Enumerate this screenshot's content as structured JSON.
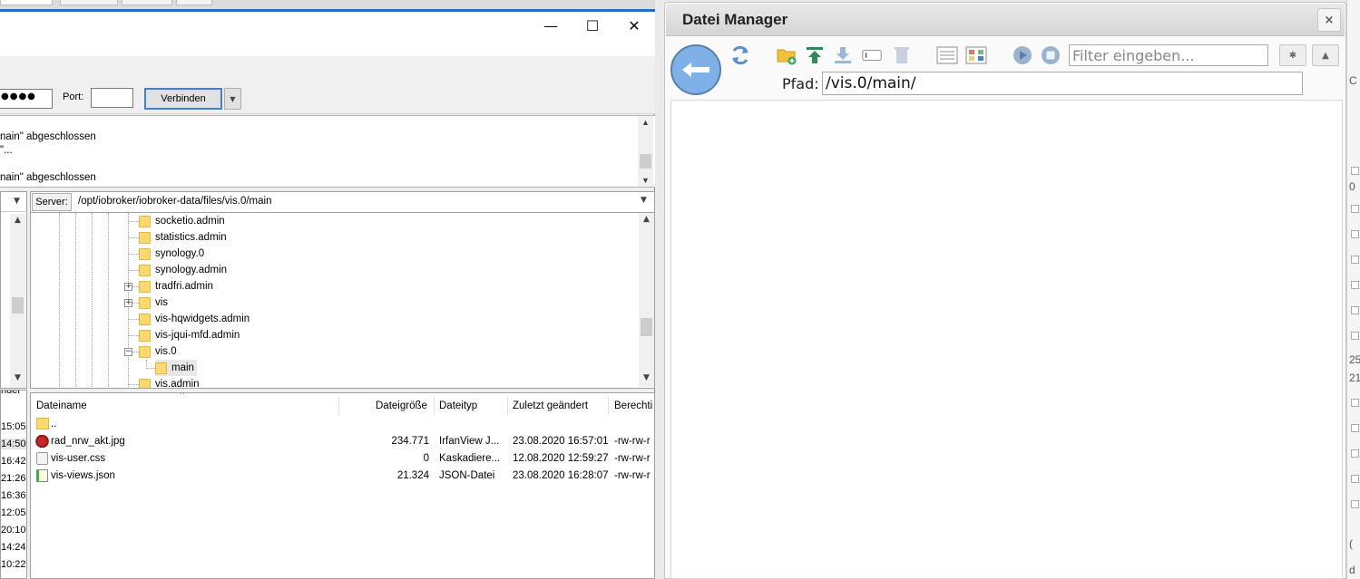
{
  "filezilla": {
    "window_controls": {
      "minimize": "—",
      "maximize": "☐",
      "close": "✕"
    },
    "quickconnect": {
      "password_masked": "●●●●",
      "port_label": "Port:",
      "port_value": "",
      "connect_button": "Verbinden",
      "dropdown_icon": "▼"
    },
    "log_lines": [
      "nain\" abgeschlossen",
      "\"...",
      "",
      "nain\" abgeschlossen"
    ],
    "server_label": "Server:",
    "server_path": "/opt/iobroker/iobroker-data/files/vis.0/main",
    "tree_items": [
      {
        "label": "socketio.admin",
        "expander": ""
      },
      {
        "label": "statistics.admin",
        "expander": ""
      },
      {
        "label": "synology.0",
        "expander": ""
      },
      {
        "label": "synology.admin",
        "expander": ""
      },
      {
        "label": "tradfri.admin",
        "expander": "+"
      },
      {
        "label": "vis",
        "expander": "+"
      },
      {
        "label": "vis-hqwidgets.admin",
        "expander": ""
      },
      {
        "label": "vis-jqui-mfd.admin",
        "expander": ""
      },
      {
        "label": "vis.0",
        "expander": "−"
      },
      {
        "label": "main",
        "expander": ""
      },
      {
        "label": "vis.admin",
        "expander": ""
      }
    ],
    "local_list_header": "nder",
    "local_times": [
      "15:05",
      "14:50",
      "16:42",
      "21:26",
      "16:36",
      "12:05",
      "20:10",
      "14:24",
      "10:22"
    ],
    "columns": {
      "name": "Dateiname",
      "size": "Dateigröße",
      "type": "Dateityp",
      "modified": "Zuletzt geändert",
      "perms": "Berechti"
    },
    "files": [
      {
        "name": "..",
        "size": "",
        "type": "",
        "modified": "",
        "perms": "",
        "icon": "folder-icon"
      },
      {
        "name": "rad_nrw_akt.jpg",
        "size": "234.771",
        "type": "IrfanView J...",
        "modified": "23.08.2020 16:57:01",
        "perms": "-rw-rw-r",
        "icon": "image-file-icon"
      },
      {
        "name": "vis-user.css",
        "size": "0",
        "type": "Kaskadiere...",
        "modified": "12.08.2020 12:59:27",
        "perms": "-rw-rw-r",
        "icon": "css-file-icon"
      },
      {
        "name": "vis-views.json",
        "size": "21.324",
        "type": "JSON-Datei",
        "modified": "23.08.2020 16:28:07",
        "perms": "-rw-rw-r",
        "icon": "json-file-icon"
      }
    ]
  },
  "dateimanager": {
    "title": "Datei Manager",
    "close_icon": "×",
    "filter_placeholder": "Filter eingeben...",
    "path_label": "Pfad:",
    "path_value": "/vis.0/main/",
    "toolbar_icons": [
      "refresh-icon",
      "new-folder-icon",
      "upload-icon",
      "download-icon",
      "rename-icon",
      "delete-icon",
      "list-view-icon",
      "grid-view-icon",
      "play-icon",
      "stop-icon",
      "settings-icon",
      "warning-icon"
    ],
    "accent_color": "#7fb1e8"
  },
  "right_strip": {
    "fragments": [
      "C",
      "0",
      "25",
      "21",
      "(",
      "d"
    ]
  }
}
